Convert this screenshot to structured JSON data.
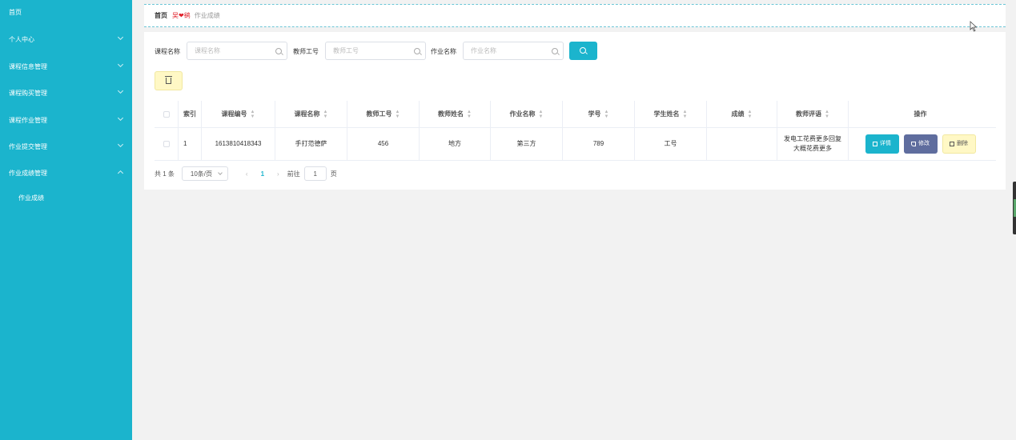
{
  "sidebar": {
    "items": [
      {
        "label": "首页",
        "expandable": false
      },
      {
        "label": "个人中心",
        "expandable": true
      },
      {
        "label": "课程信息管理",
        "expandable": true
      },
      {
        "label": "课程购买管理",
        "expandable": true
      },
      {
        "label": "课程作业管理",
        "expandable": true
      },
      {
        "label": "作业提交管理",
        "expandable": true
      },
      {
        "label": "作业成绩管理",
        "expandable": true,
        "expanded": true
      }
    ],
    "submenu": [
      {
        "label": "作业成绩"
      }
    ]
  },
  "breadcrumb": {
    "home": "首页",
    "separator": "吴❤鹆",
    "current": "作业成绩"
  },
  "search": {
    "course_name_label": "课程名称",
    "course_name_placeholder": "课程名称",
    "teacher_id_label": "教师工号",
    "teacher_id_placeholder": "教师工号",
    "homework_name_label": "作业名称",
    "homework_name_placeholder": "作业名称"
  },
  "table": {
    "columns": [
      "索引",
      "课程编号",
      "课程名称",
      "教师工号",
      "教师姓名",
      "作业名称",
      "学号",
      "学生姓名",
      "成绩",
      "教师评语",
      "操作"
    ],
    "rows": [
      {
        "index": "1",
        "course_no": "1613810418343",
        "course_name": "手打范德萨",
        "teacher_id": "456",
        "teacher_name": "地方",
        "homework_name": "第三方",
        "student_no": "789",
        "student_name": "工号",
        "score": "",
        "comment": "发电工花费更多回复大概花费更多"
      }
    ],
    "actions": {
      "detail": "详情",
      "edit": "修改",
      "delete": "删除"
    }
  },
  "pagination": {
    "total": "共 1 条",
    "page_size": "10条/页",
    "current_page": "1",
    "goto_label": "前往",
    "goto_value": "1",
    "page_suffix": "页"
  },
  "colors": {
    "accent": "#1bb4cd",
    "edit_button": "#5f6d9e",
    "delete_button": "#fff8c5",
    "breadcrumb_separator": "#e0202a"
  }
}
